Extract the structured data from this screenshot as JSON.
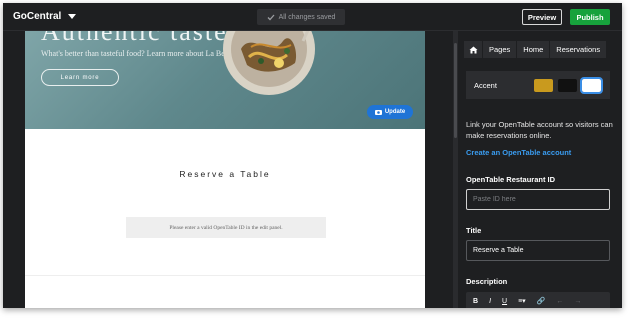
{
  "topbar": {
    "brand": "GoCentral",
    "saved_status": "All changes saved",
    "preview_label": "Preview",
    "publish_label": "Publish",
    "colors": {
      "publish": "#17a23c"
    }
  },
  "hero": {
    "title": "Authentic tastes",
    "subtitle": "What's better than tasteful food? Learn more about La Bella's start",
    "learn_more_label": "Learn more",
    "update_label": "Update"
  },
  "section": {
    "title": "Reserve a Table",
    "notice": "Please enter a valid OpenTable ID in the edit panel."
  },
  "panel": {
    "tabs": [
      {
        "icon": "home-icon"
      },
      {
        "label": "Pages"
      },
      {
        "label": "Home"
      },
      {
        "label": "Reservations"
      }
    ],
    "accent": {
      "label": "Accent",
      "swatches": [
        "#c99a1e",
        "#111111",
        "#ffffff"
      ],
      "selected_index": 2
    },
    "link_text": "Link your OpenTable account so visitors can make reservations online.",
    "link_label": "Create an OpenTable account",
    "opentable": {
      "label": "OpenTable Restaurant ID",
      "placeholder": "Paste ID here",
      "value": ""
    },
    "title_field": {
      "label": "Title",
      "value": "Reserve a Table"
    },
    "description": {
      "label": "Description"
    },
    "toolbar": [
      "B",
      "I",
      "U",
      "≡▾",
      "🔗",
      "←",
      "→"
    ]
  }
}
